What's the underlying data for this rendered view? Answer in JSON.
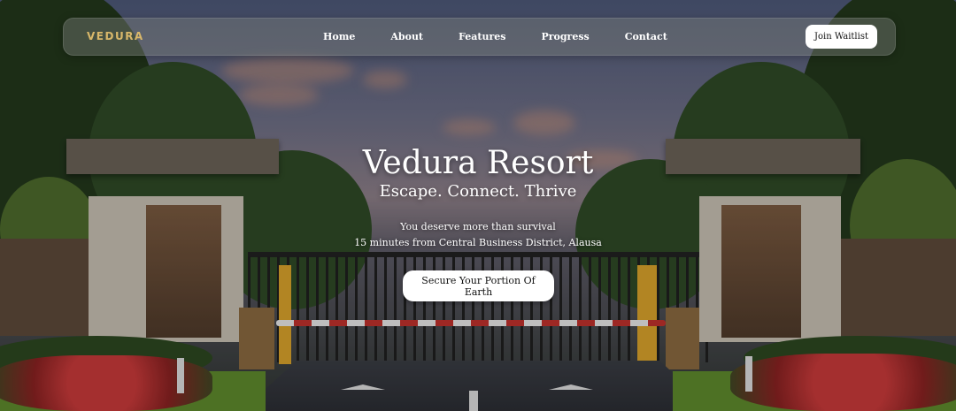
{
  "brand": {
    "logo_text": "VEDURA",
    "logo_color": "#d9b86a"
  },
  "nav": {
    "links": [
      "Home",
      "About",
      "Features",
      "Progress",
      "Contact"
    ],
    "cta_label": "Join Waitlist"
  },
  "hero": {
    "title": "Vedura Resort",
    "tagline": "Escape. Connect. Thrive",
    "line1": "You deserve more than survival",
    "line2": "15 minutes from Central Business District, Alausa",
    "cta_label": "Secure Your Portion Of Earth"
  },
  "background": {
    "description_icon": "resort-gate-photo"
  }
}
